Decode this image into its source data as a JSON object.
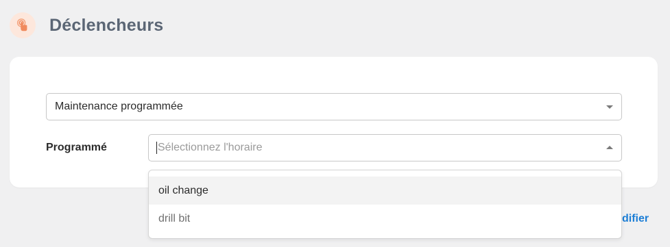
{
  "header": {
    "title": "Déclencheurs",
    "icon": "touch-icon",
    "icon_color": "#f08a5d"
  },
  "trigger_select": {
    "value": "Maintenance programmée"
  },
  "schedule": {
    "label": "Programmé",
    "placeholder": "Sélectionnez l'horaire"
  },
  "dropdown": {
    "options": [
      {
        "label": "oil change",
        "highlighted": true
      },
      {
        "label": "drill bit",
        "highlighted": false
      }
    ]
  },
  "footer": {
    "modify_label": "difier"
  },
  "colors": {
    "accent": "#1c7ed6",
    "title": "#5b6675"
  }
}
